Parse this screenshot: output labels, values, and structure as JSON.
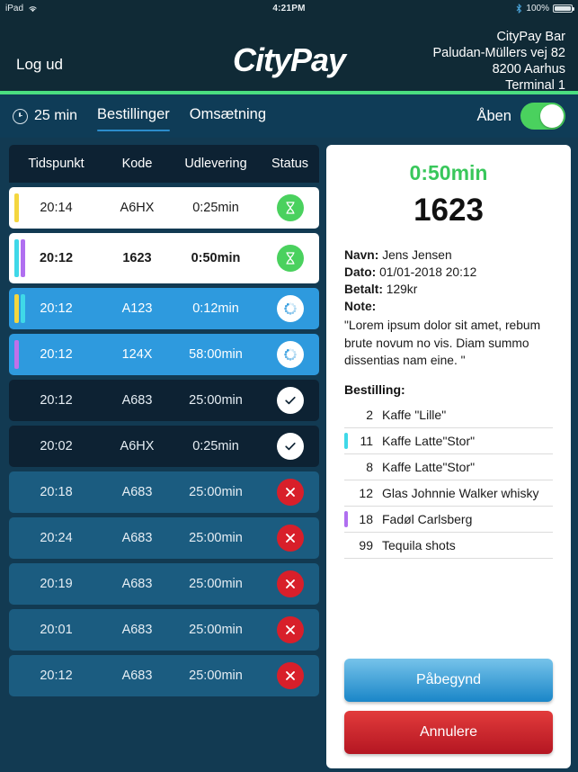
{
  "status_bar": {
    "device": "iPad",
    "wifi_icon": "wifi-icon",
    "time": "4:21PM",
    "bluetooth_icon": "bluetooth-icon",
    "battery_percent": "100%"
  },
  "header": {
    "logout_label": "Log ud",
    "brand": "CityPay",
    "venue_lines": [
      "CityPay Bar",
      "Paludan-Müllers vej 82",
      "8200 Aarhus",
      "Terminal 1"
    ],
    "accent_color": "#4ade80"
  },
  "navbar": {
    "clock_icon": "clock-icon",
    "timer_label": "25 min",
    "tabs": [
      {
        "label": "Bestillinger",
        "active": true
      },
      {
        "label": "Omsætning",
        "active": false
      }
    ],
    "open_label": "Åben",
    "toggle_on": true,
    "toggle_color": "#4ad15e",
    "active_tab_underline_color": "#2b8ccc"
  },
  "orders_table": {
    "columns": [
      "Tidspunkt",
      "Kode",
      "Udlevering",
      "Status"
    ],
    "rows": [
      {
        "time": "20:14",
        "code": "A6HX",
        "delivery": "0:25min",
        "status": "hourglass",
        "style": "white",
        "stripes": [
          "#f4d63f"
        ]
      },
      {
        "time": "20:12",
        "code": "1623",
        "delivery": "0:50min",
        "status": "hourglass",
        "style": "white",
        "stripes": [
          "#3fd8e8",
          "#b06ff0"
        ],
        "bold": true,
        "tall": true
      },
      {
        "time": "20:12",
        "code": "A123",
        "delivery": "0:12min",
        "status": "spinner",
        "style": "sel",
        "stripes": [
          "#f4d63f",
          "#3fd8e8"
        ]
      },
      {
        "time": "20:12",
        "code": "124X",
        "delivery": "58:00min",
        "status": "spinner",
        "style": "sel",
        "stripes": [
          "#c070ea"
        ]
      },
      {
        "time": "20:12",
        "code": "A683",
        "delivery": "25:00min",
        "status": "check",
        "style": "dark",
        "stripes": []
      },
      {
        "time": "20:02",
        "code": "A6HX",
        "delivery": "0:25min",
        "status": "check",
        "style": "dark",
        "stripes": []
      },
      {
        "time": "20:18",
        "code": "A683",
        "delivery": "25:00min",
        "status": "cancel",
        "style": "medium",
        "stripes": []
      },
      {
        "time": "20:24",
        "code": "A683",
        "delivery": "25:00min",
        "status": "cancel",
        "style": "medium",
        "stripes": []
      },
      {
        "time": "20:19",
        "code": "A683",
        "delivery": "25:00min",
        "status": "cancel",
        "style": "medium",
        "stripes": []
      },
      {
        "time": "20:01",
        "code": "A683",
        "delivery": "25:00min",
        "status": "cancel",
        "style": "medium",
        "stripes": []
      },
      {
        "time": "20:12",
        "code": "A683",
        "delivery": "25:00min",
        "status": "cancel",
        "style": "medium",
        "stripes": []
      }
    ]
  },
  "detail": {
    "timer": "0:50min",
    "timer_color": "#39c75b",
    "code": "1623",
    "name_label": "Navn:",
    "name_value": "Jens Jensen",
    "date_label": "Dato:",
    "date_value": "01/01-2018 20:12",
    "paid_label": "Betalt:",
    "paid_value": "129kr",
    "note_label": "Note:",
    "note_value": "\"Lorem ipsum dolor sit amet, rebum brute novum no vis. Diam summo dissentias nam eine. \"",
    "order_title": "Bestilling:",
    "items": [
      {
        "qty": "2",
        "name": "Kaffe \"Lille\"",
        "mark": ""
      },
      {
        "qty": "11",
        "name": "Kaffe Latte\"Stor\"",
        "mark": "#3fd8e8"
      },
      {
        "qty": "8",
        "name": "Kaffe Latte\"Stor\"",
        "mark": ""
      },
      {
        "qty": "12",
        "name": "Glas Johnnie Walker whisky",
        "mark": ""
      },
      {
        "qty": "18",
        "name": "Fadøl Carlsberg",
        "mark": "#b06ff0"
      },
      {
        "qty": "99",
        "name": "Tequila shots",
        "mark": ""
      }
    ],
    "primary_button": "Påbegynd",
    "secondary_button": "Annulere",
    "primary_color": "#1a86c8",
    "secondary_color": "#b41622"
  }
}
